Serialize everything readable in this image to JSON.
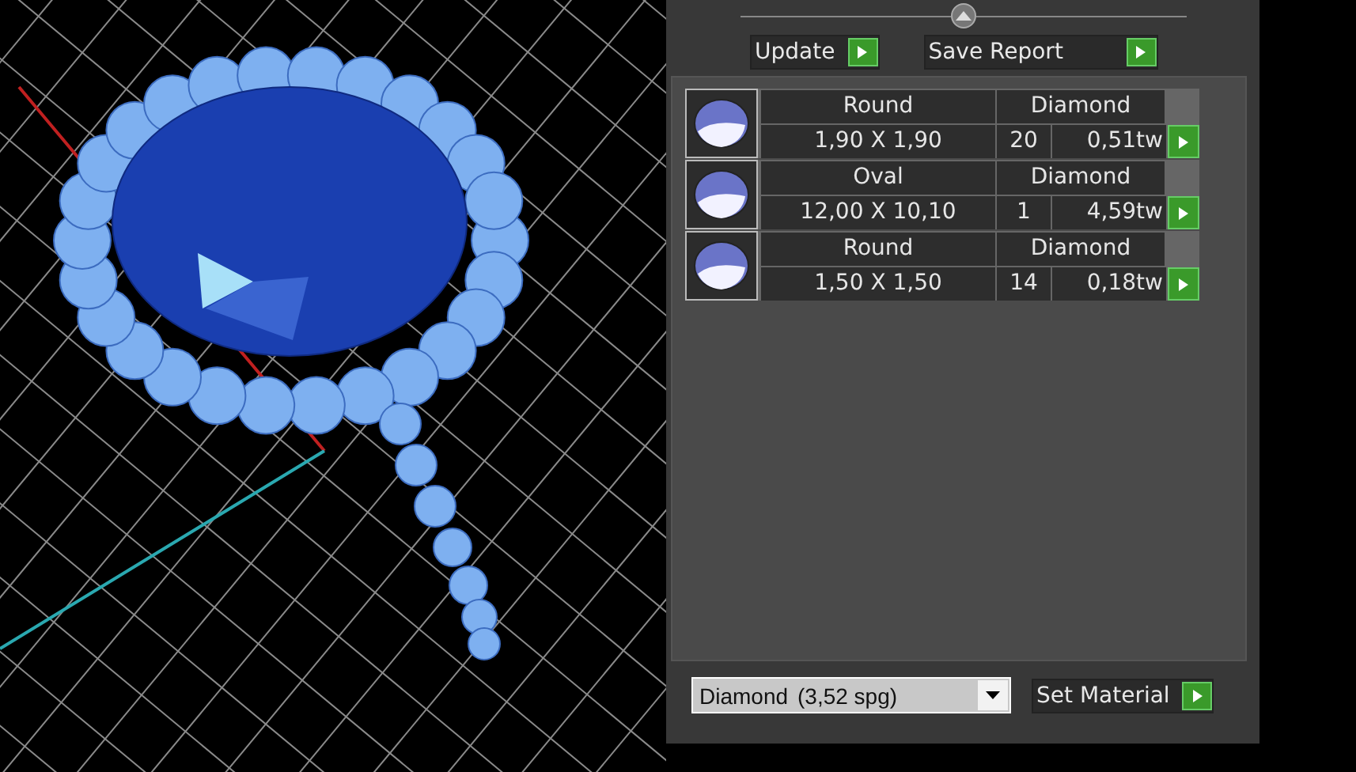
{
  "toolbar": {
    "buttons": [
      {
        "label": "Update"
      },
      {
        "label": "Save Report"
      }
    ]
  },
  "stones": [
    {
      "shape": "Round",
      "material": "Diamond",
      "size": "1,90 X 1,90",
      "count": "20",
      "weight": "0,51tw"
    },
    {
      "shape": "Oval",
      "material": "Diamond",
      "size": "12,00 X 10,10",
      "count": "1",
      "weight": "4,59tw"
    },
    {
      "shape": "Round",
      "material": "Diamond",
      "size": "1,50 X 1,50",
      "count": "14",
      "weight": "0,18tw"
    }
  ],
  "material_select": {
    "name": "Diamond",
    "density": "(3,52 spg)"
  },
  "set_material": {
    "label": "Set Material"
  }
}
